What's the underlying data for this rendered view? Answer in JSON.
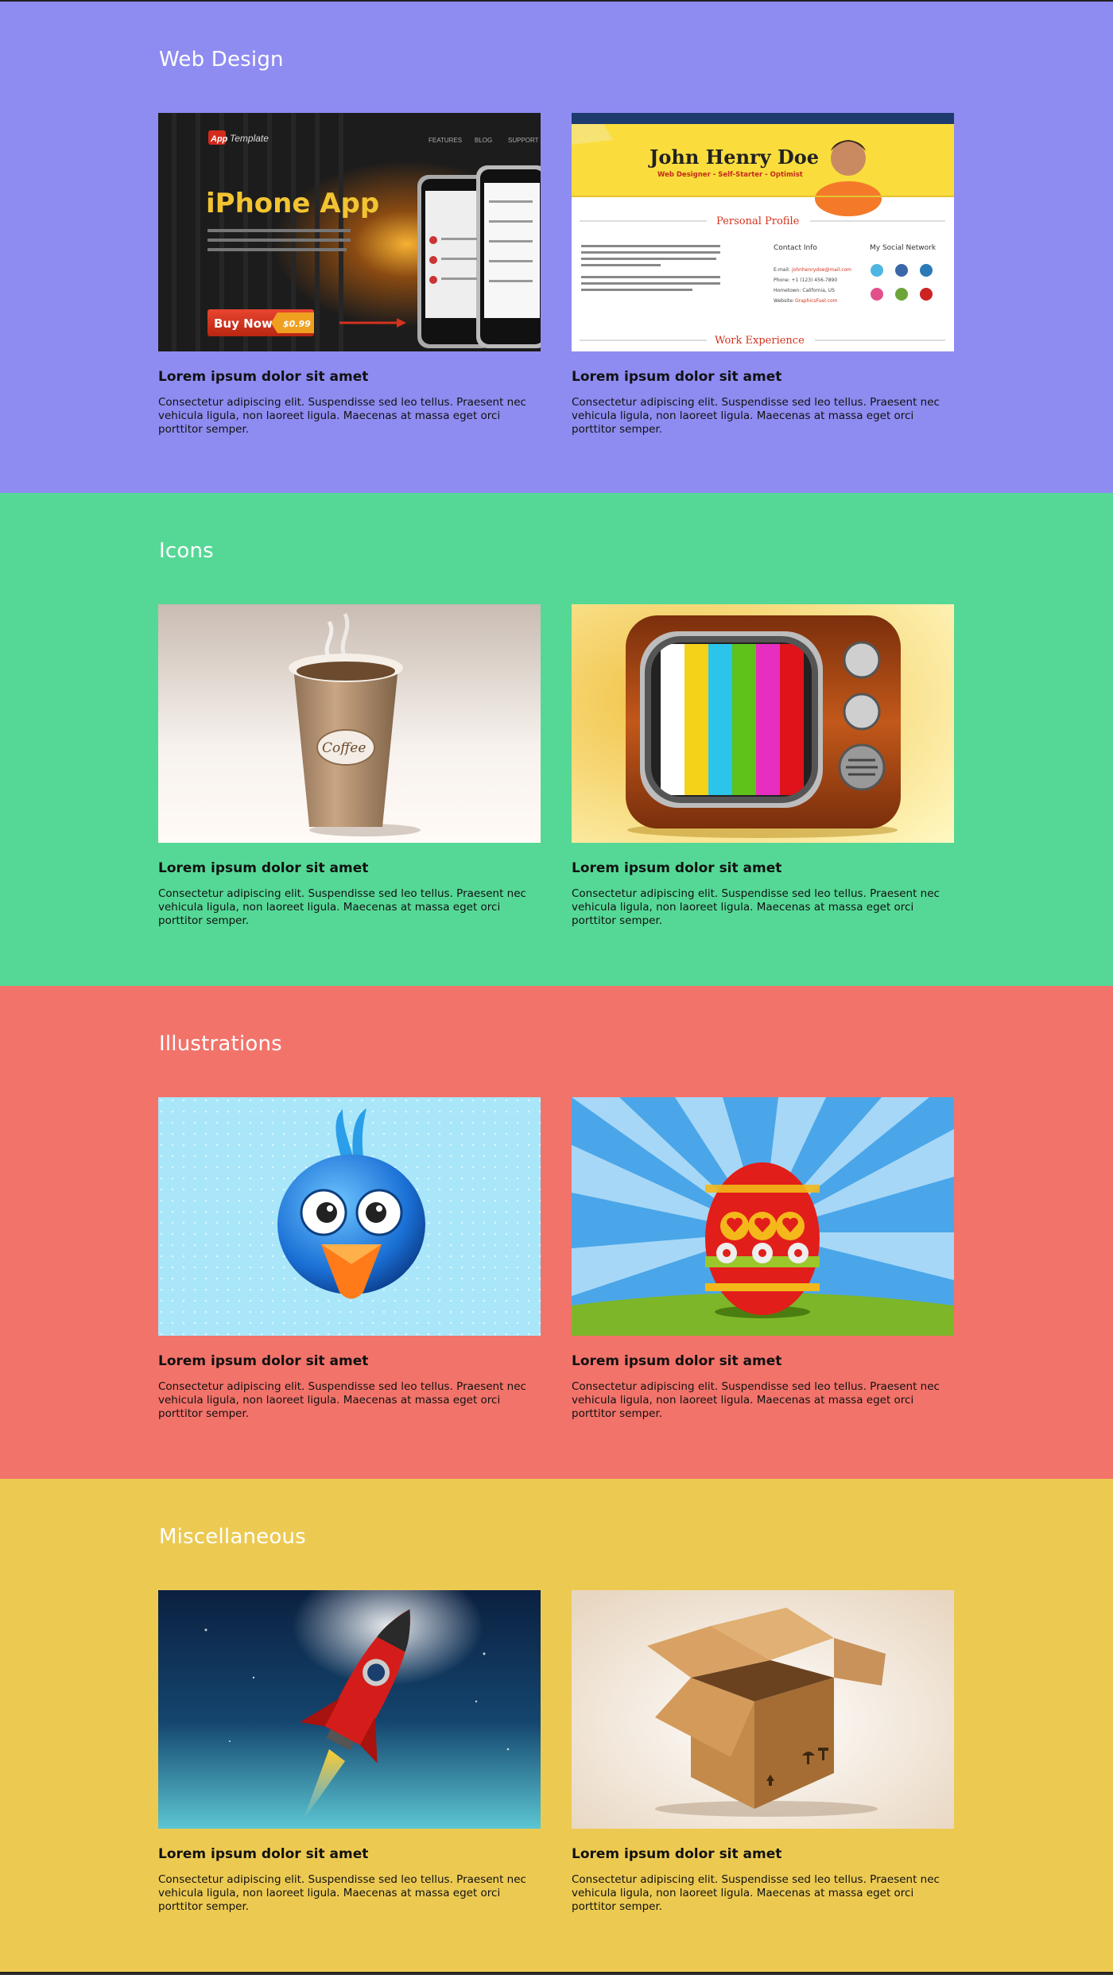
{
  "sections": [
    {
      "title": "Web Design",
      "color": "#8e8cf1",
      "cards": [
        {
          "image": "iphone-app-template",
          "image_text": {
            "logo": "App",
            "logo_suffix": "Template",
            "nav": [
              "FEATURES",
              "BLOG",
              "SUPPORT"
            ],
            "headline": "iPhone App",
            "button": "Buy Now",
            "price": "$0.99"
          },
          "title": "Lorem ipsum dolor sit amet",
          "description": "Consectetur adipiscing elit. Suspendisse sed leo tellus. Praesent nec vehicula ligula, non laoreet ligula. Maecenas at massa eget orci porttitor semper."
        },
        {
          "image": "resume-template",
          "image_text": {
            "name": "John Henry Doe",
            "tagline": "Web Designer - Self-Starter - Optimist",
            "profile_heading": "Personal Profile",
            "contact_heading": "Contact Info",
            "social_heading": "My Social Network",
            "work_heading": "Work Experience",
            "email_label": "E-mail:",
            "email": "johnhenrydoe@mail.com",
            "phone": "Phone: +1 (123) 456-7890",
            "hometown": "Hometown: California, US",
            "website_label": "Website:",
            "website": "GraphicsFuel.com"
          },
          "title": "Lorem ipsum dolor sit amet",
          "description": "Consectetur adipiscing elit. Suspendisse sed leo tellus. Praesent nec vehicula ligula, non laoreet ligula. Maecenas at massa eget orci porttitor semper."
        }
      ]
    },
    {
      "title": "Icons",
      "color": "#55d896",
      "cards": [
        {
          "image": "coffee-cup-icon",
          "image_text": {
            "label": "Coffee"
          },
          "title": "Lorem ipsum dolor sit amet",
          "description": "Consectetur adipiscing elit. Suspendisse sed leo tellus. Praesent nec vehicula ligula, non laoreet ligula. Maecenas at massa eget orci porttitor semper."
        },
        {
          "image": "retro-tv-icon",
          "title": "Lorem ipsum dolor sit amet",
          "description": "Consectetur adipiscing elit. Suspendisse sed leo tellus. Praesent nec vehicula ligula, non laoreet ligula. Maecenas at massa eget orci porttitor semper."
        }
      ]
    },
    {
      "title": "Illustrations",
      "color": "#f2736a",
      "cards": [
        {
          "image": "blue-bird-illustration",
          "title": "Lorem ipsum dolor sit amet",
          "description": "Consectetur adipiscing elit. Suspendisse sed leo tellus. Praesent nec vehicula ligula, non laoreet ligula. Maecenas at massa eget orci porttitor semper."
        },
        {
          "image": "easter-egg-illustration",
          "title": "Lorem ipsum dolor sit amet",
          "description": "Consectetur adipiscing elit. Suspendisse sed leo tellus. Praesent nec vehicula ligula, non laoreet ligula. Maecenas at massa eget orci porttitor semper."
        }
      ]
    },
    {
      "title": "Miscellaneous",
      "color": "#ecca52",
      "cards": [
        {
          "image": "rocket-illustration",
          "title": "Lorem ipsum dolor sit amet",
          "description": "Consectetur adipiscing elit. Suspendisse sed leo tellus. Praesent nec vehicula ligula, non laoreet ligula. Maecenas at massa eget orci porttitor semper."
        },
        {
          "image": "cardboard-box-illustration",
          "title": "Lorem ipsum dolor sit amet",
          "description": "Consectetur adipiscing elit. Suspendisse sed leo tellus. Praesent nec vehicula ligula, non laoreet ligula. Maecenas at massa eget orci porttitor semper."
        }
      ]
    }
  ]
}
